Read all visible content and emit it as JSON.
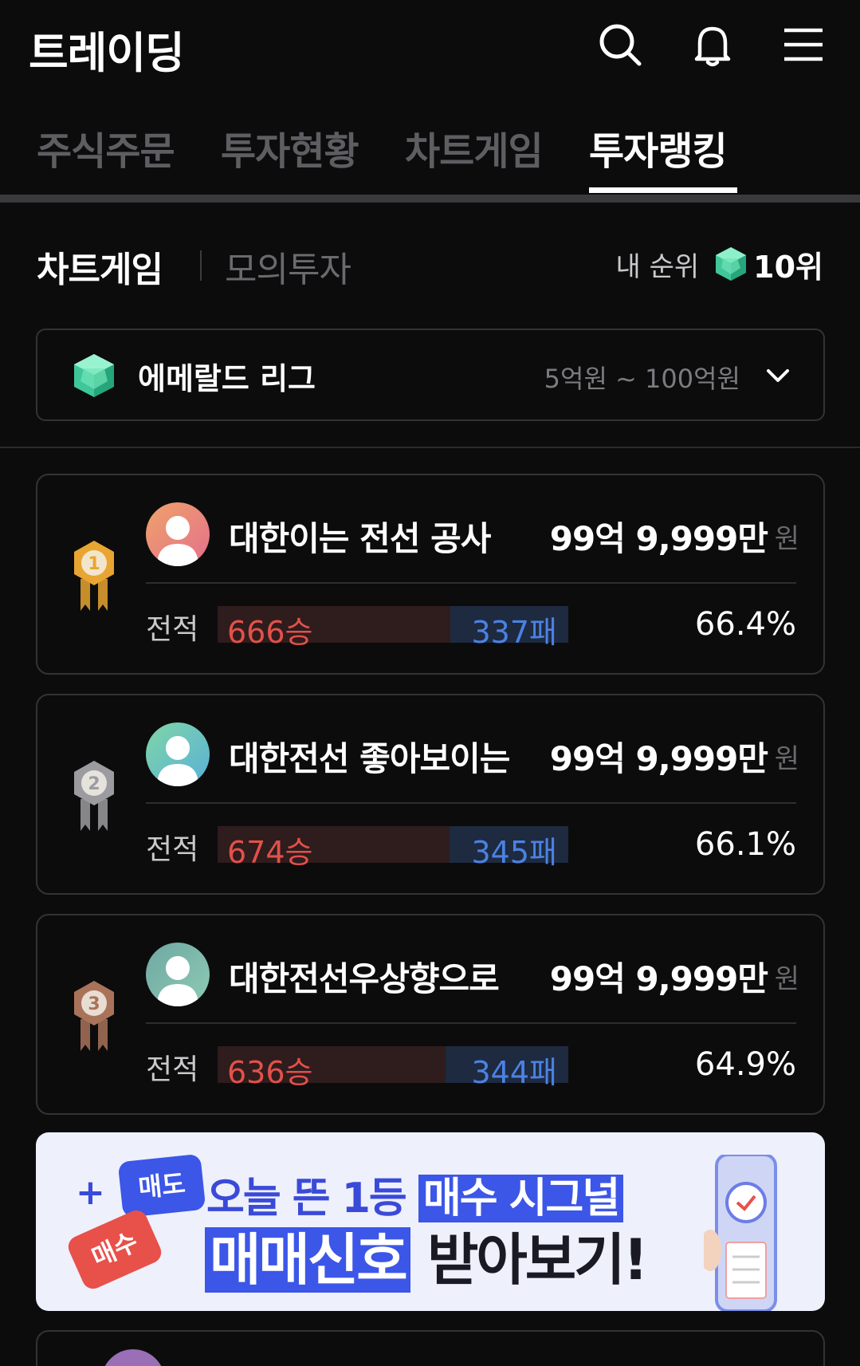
{
  "header": {
    "title": "트레이딩",
    "icons": [
      "search-icon",
      "bell-icon",
      "menu-icon"
    ]
  },
  "tabs": [
    {
      "label": "주식주문",
      "active": false
    },
    {
      "label": "투자현황",
      "active": false
    },
    {
      "label": "차트게임",
      "active": false
    },
    {
      "label": "투자랭킹",
      "active": true
    }
  ],
  "subtabs": {
    "primary": "차트게임",
    "secondary": "모의투자",
    "my_rank_label": "내 순위",
    "my_rank_value": "10위"
  },
  "league": {
    "name": "에메랄드 리그",
    "range": "5억원 ~ 100억원"
  },
  "ranking": [
    {
      "rank": 1,
      "nickname": "대한이는 전선 공사",
      "amount": "99억 9,999만",
      "unit": "원",
      "record_label": "전적",
      "wins": "666승",
      "losses": "337패",
      "win_ratio": 0.664,
      "rate": "66.4%",
      "medal_color": "#e8a531",
      "avatar_colors": [
        "#f0a36a",
        "#e36f8c"
      ]
    },
    {
      "rank": 2,
      "nickname": "대한전선 좋아보이는",
      "amount": "99억 9,999만",
      "unit": "원",
      "record_label": "전적",
      "wins": "674승",
      "losses": "345패",
      "win_ratio": 0.661,
      "rate": "66.1%",
      "medal_color": "#9c9ca0",
      "avatar_colors": [
        "#7fd6a6",
        "#5ab0d8"
      ]
    },
    {
      "rank": 3,
      "nickname": "대한전선우상향으로",
      "amount": "99억 9,999만",
      "unit": "원",
      "record_label": "전적",
      "wins": "636승",
      "losses": "344패",
      "win_ratio": 0.649,
      "rate": "64.9%",
      "medal_color": "#a9735a",
      "avatar_colors": [
        "#6fa7a2",
        "#8ecbb4"
      ]
    }
  ],
  "banner": {
    "sell_bubble": "매도",
    "buy_bubble": "매수",
    "line1_prefix": "오늘 뜬 1등 ",
    "line1_highlight": "매수 시그널",
    "line2_highlight": "매매신호",
    "line2_suffix": " 받아보기!"
  }
}
